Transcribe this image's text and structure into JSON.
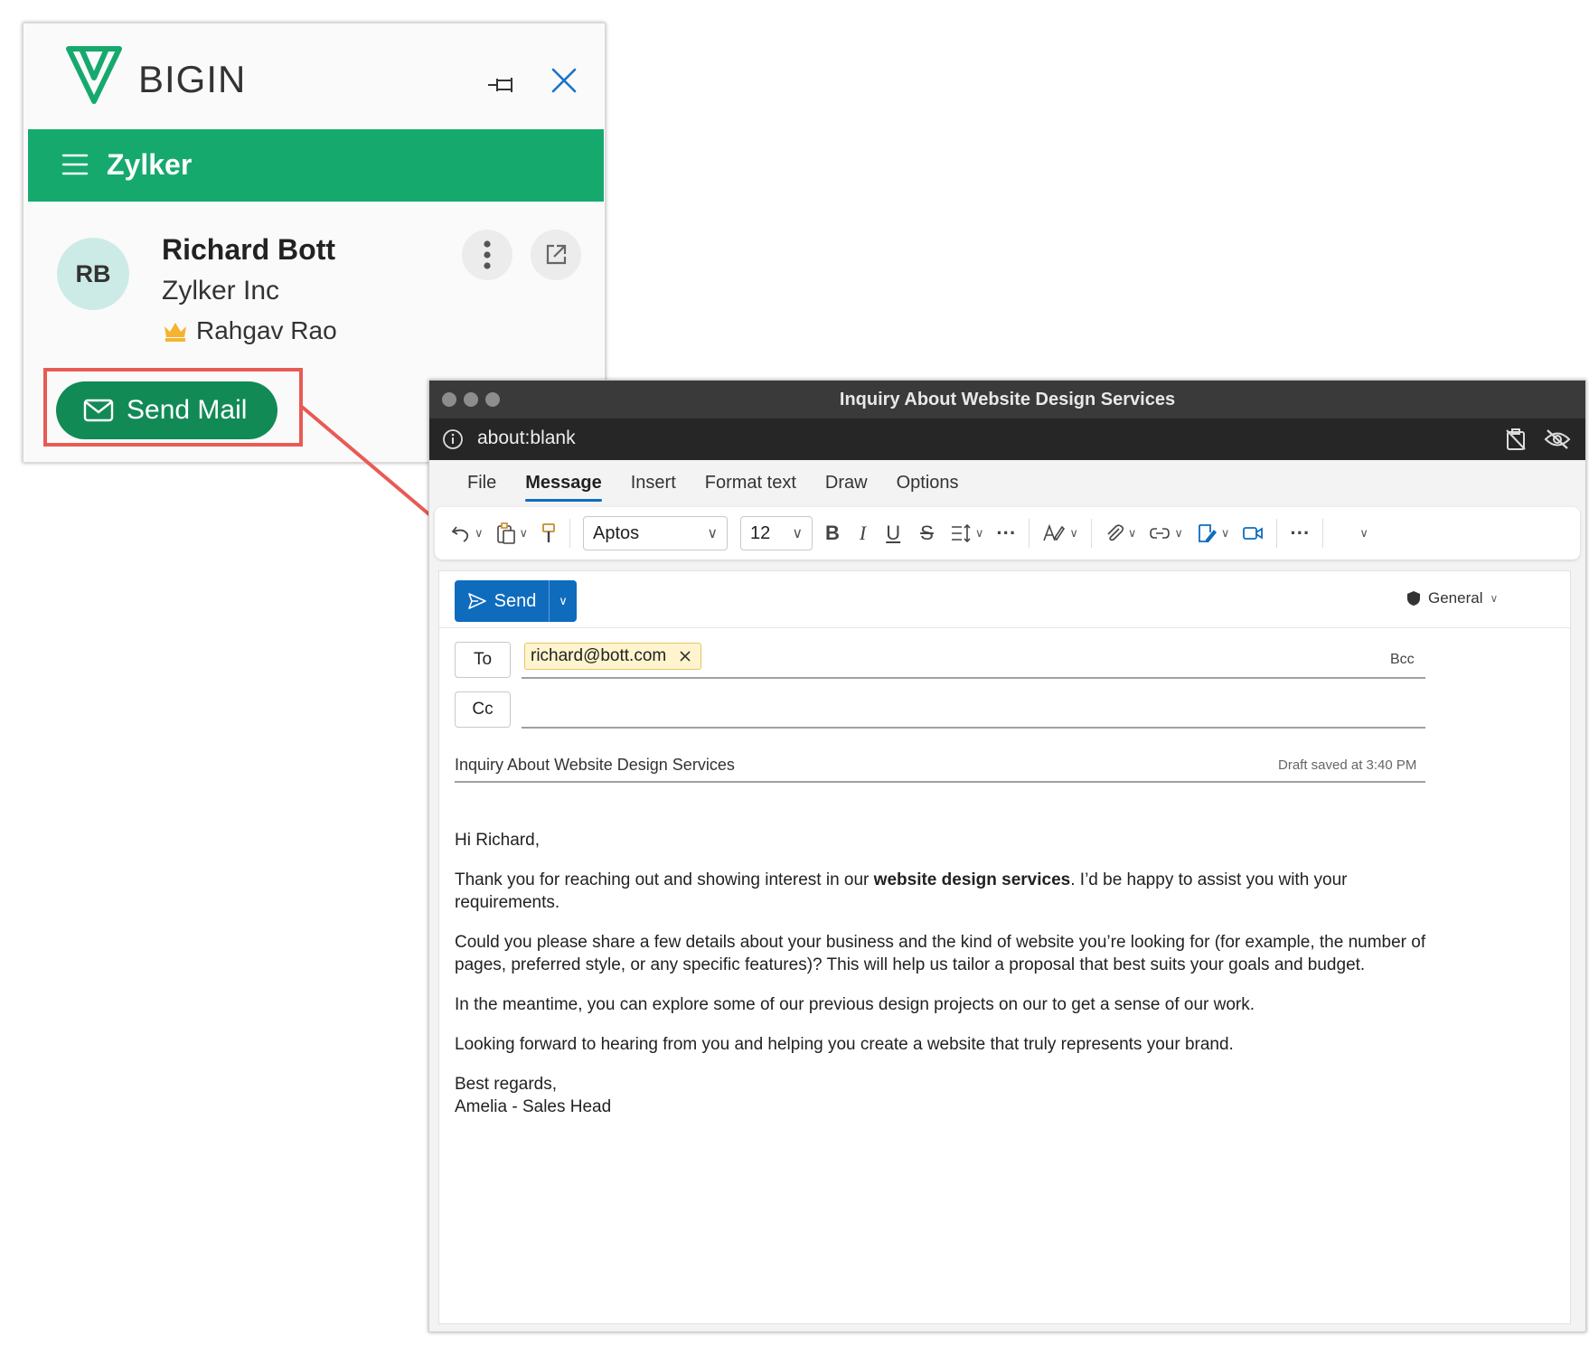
{
  "bigin": {
    "brand": "BIGIN",
    "org_name": "Zylker",
    "contact": {
      "initials": "RB",
      "name": "Richard Bott",
      "company": "Zylker Inc",
      "owner": "Rahgav Rao"
    },
    "send_mail_label": "Send Mail",
    "colors": {
      "green_bar": "#16a96e",
      "send_button": "#128a56",
      "highlight": "#e85b54"
    }
  },
  "outlook": {
    "window_title": "Inquiry About Website Design Services",
    "url": "about:blank",
    "tabs": [
      {
        "label": "File",
        "active": false
      },
      {
        "label": "Message",
        "active": true
      },
      {
        "label": "Insert",
        "active": false
      },
      {
        "label": "Format text",
        "active": false
      },
      {
        "label": "Draw",
        "active": false
      },
      {
        "label": "Options",
        "active": false
      }
    ],
    "ribbon": {
      "font_name": "Aptos",
      "font_size": "12",
      "bold_glyph": "B",
      "italic_glyph": "I",
      "underline_glyph": "U",
      "strike_glyph": "S",
      "more_glyph": "···"
    },
    "send_label": "Send",
    "sensitivity": "General",
    "to_label": "To",
    "cc_label": "Cc",
    "recipient": "richard@bott.com",
    "bcc_label": "Bcc",
    "subject": "Inquiry About Website Design Services",
    "draft_status": "Draft saved at 3:40 PM",
    "body": {
      "greeting": "Hi Richard,",
      "p1_before": "Thank you for reaching out and showing interest in our ",
      "p1_bold": "website design services",
      "p1_after": ". I’d be happy to assist you with your requirements.",
      "p2": "Could you please share a few details about your business and the kind of website you’re looking for (for example, the number of pages, preferred style, or any specific features)? This will help us tailor a proposal that best suits your goals and budget.",
      "p3": "In the meantime, you can explore some of our previous design projects on our to get a sense of our work.",
      "p4": "Looking forward to hearing from you and helping you create a website that truly represents your brand.",
      "signoff": "Best regards,",
      "signature": "Amelia - Sales Head"
    },
    "colors": {
      "accent": "#0f6cbd",
      "titlebar": "#3a3a3a",
      "chip_bg": "#fff4ce"
    }
  }
}
